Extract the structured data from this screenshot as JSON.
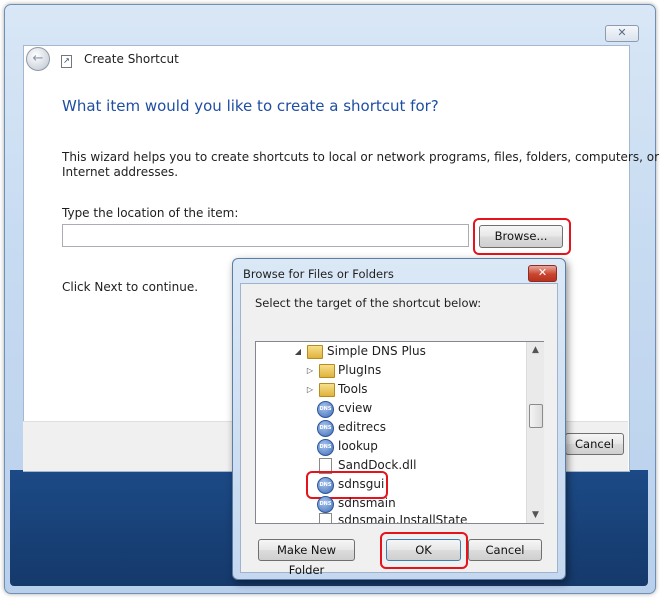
{
  "wizard": {
    "title": "Create Shortcut",
    "close_glyph": "✕",
    "heading": "What item would you like to create a shortcut for?",
    "description_line1": "This wizard helps you to create shortcuts to local or network programs, files, folders, computers, or",
    "description_line2": "Internet addresses.",
    "location_label": "Type the location of the item:",
    "location_value": "",
    "browse_label": "Browse...",
    "continue_text": "Click Next to continue.",
    "cancel_label": "Cancel"
  },
  "browse_dialog": {
    "title": "Browse for Files or Folders",
    "close_glyph": "✕",
    "instruction": "Select the target of the shortcut below:",
    "tree_items": [
      {
        "label": "Simple DNS Plus",
        "icon": "folder-icon",
        "expander": "expanded"
      },
      {
        "label": "PlugIns",
        "icon": "folder-icon",
        "expander": "collapsed"
      },
      {
        "label": "Tools",
        "icon": "folder-icon",
        "expander": "collapsed"
      },
      {
        "label": "cview",
        "icon": "dns-icon"
      },
      {
        "label": "editrecs",
        "icon": "dns-icon"
      },
      {
        "label": "lookup",
        "icon": "dns-icon"
      },
      {
        "label": "SandDock.dll",
        "icon": "file-icon"
      },
      {
        "label": "sdnsgui",
        "icon": "dns-icon",
        "selected": true
      },
      {
        "label": "sdnsmain",
        "icon": "dns-icon"
      },
      {
        "label": "sdnsmain.InstallState",
        "icon": "file-icon"
      }
    ],
    "make_folder_label": "Make New Folder",
    "ok_label": "OK",
    "cancel_label": "Cancel"
  },
  "colors": {
    "heading": "#1f4ea3",
    "highlight": "#e5131b",
    "desktop": "#1c4a86"
  }
}
